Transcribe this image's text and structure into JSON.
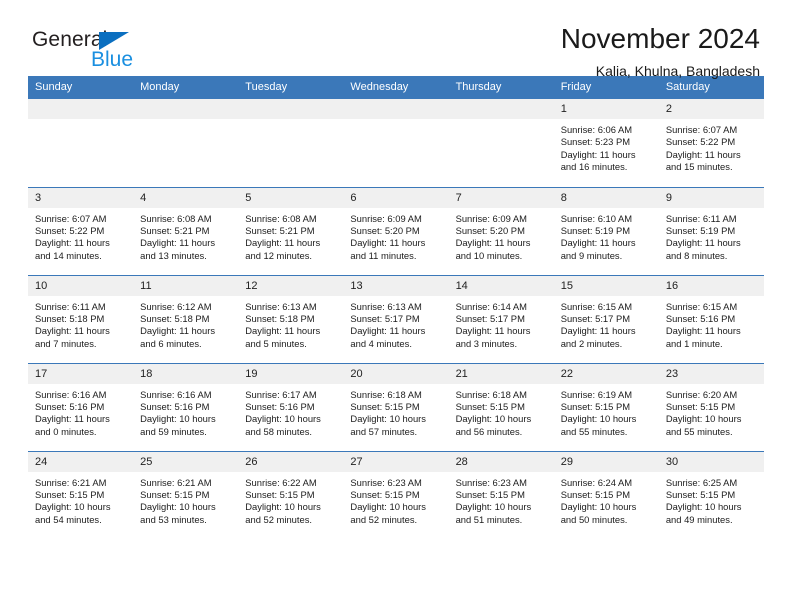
{
  "brand": {
    "name_dark": "General",
    "name_light": "Blue",
    "accent_color": "#1a8fe0",
    "flag_color": "#0b6fc0"
  },
  "header": {
    "title": "November 2024",
    "location": "Kalia, Khulna, Bangladesh"
  },
  "calendar": {
    "header_color": "#3b78b9",
    "daynum_bg": "#f0f0f0",
    "weekday_headers": [
      "Sunday",
      "Monday",
      "Tuesday",
      "Wednesday",
      "Thursday",
      "Friday",
      "Saturday"
    ],
    "weeks": [
      [
        {
          "day": "",
          "empty": true
        },
        {
          "day": "",
          "empty": true
        },
        {
          "day": "",
          "empty": true
        },
        {
          "day": "",
          "empty": true
        },
        {
          "day": "",
          "empty": true
        },
        {
          "day": "1",
          "sunrise": "Sunrise: 6:06 AM",
          "sunset": "Sunset: 5:23 PM",
          "daylight": "Daylight: 11 hours and 16 minutes."
        },
        {
          "day": "2",
          "sunrise": "Sunrise: 6:07 AM",
          "sunset": "Sunset: 5:22 PM",
          "daylight": "Daylight: 11 hours and 15 minutes."
        }
      ],
      [
        {
          "day": "3",
          "sunrise": "Sunrise: 6:07 AM",
          "sunset": "Sunset: 5:22 PM",
          "daylight": "Daylight: 11 hours and 14 minutes."
        },
        {
          "day": "4",
          "sunrise": "Sunrise: 6:08 AM",
          "sunset": "Sunset: 5:21 PM",
          "daylight": "Daylight: 11 hours and 13 minutes."
        },
        {
          "day": "5",
          "sunrise": "Sunrise: 6:08 AM",
          "sunset": "Sunset: 5:21 PM",
          "daylight": "Daylight: 11 hours and 12 minutes."
        },
        {
          "day": "6",
          "sunrise": "Sunrise: 6:09 AM",
          "sunset": "Sunset: 5:20 PM",
          "daylight": "Daylight: 11 hours and 11 minutes."
        },
        {
          "day": "7",
          "sunrise": "Sunrise: 6:09 AM",
          "sunset": "Sunset: 5:20 PM",
          "daylight": "Daylight: 11 hours and 10 minutes."
        },
        {
          "day": "8",
          "sunrise": "Sunrise: 6:10 AM",
          "sunset": "Sunset: 5:19 PM",
          "daylight": "Daylight: 11 hours and 9 minutes."
        },
        {
          "day": "9",
          "sunrise": "Sunrise: 6:11 AM",
          "sunset": "Sunset: 5:19 PM",
          "daylight": "Daylight: 11 hours and 8 minutes."
        }
      ],
      [
        {
          "day": "10",
          "sunrise": "Sunrise: 6:11 AM",
          "sunset": "Sunset: 5:18 PM",
          "daylight": "Daylight: 11 hours and 7 minutes."
        },
        {
          "day": "11",
          "sunrise": "Sunrise: 6:12 AM",
          "sunset": "Sunset: 5:18 PM",
          "daylight": "Daylight: 11 hours and 6 minutes."
        },
        {
          "day": "12",
          "sunrise": "Sunrise: 6:13 AM",
          "sunset": "Sunset: 5:18 PM",
          "daylight": "Daylight: 11 hours and 5 minutes."
        },
        {
          "day": "13",
          "sunrise": "Sunrise: 6:13 AM",
          "sunset": "Sunset: 5:17 PM",
          "daylight": "Daylight: 11 hours and 4 minutes."
        },
        {
          "day": "14",
          "sunrise": "Sunrise: 6:14 AM",
          "sunset": "Sunset: 5:17 PM",
          "daylight": "Daylight: 11 hours and 3 minutes."
        },
        {
          "day": "15",
          "sunrise": "Sunrise: 6:15 AM",
          "sunset": "Sunset: 5:17 PM",
          "daylight": "Daylight: 11 hours and 2 minutes."
        },
        {
          "day": "16",
          "sunrise": "Sunrise: 6:15 AM",
          "sunset": "Sunset: 5:16 PM",
          "daylight": "Daylight: 11 hours and 1 minute."
        }
      ],
      [
        {
          "day": "17",
          "sunrise": "Sunrise: 6:16 AM",
          "sunset": "Sunset: 5:16 PM",
          "daylight": "Daylight: 11 hours and 0 minutes."
        },
        {
          "day": "18",
          "sunrise": "Sunrise: 6:16 AM",
          "sunset": "Sunset: 5:16 PM",
          "daylight": "Daylight: 10 hours and 59 minutes."
        },
        {
          "day": "19",
          "sunrise": "Sunrise: 6:17 AM",
          "sunset": "Sunset: 5:16 PM",
          "daylight": "Daylight: 10 hours and 58 minutes."
        },
        {
          "day": "20",
          "sunrise": "Sunrise: 6:18 AM",
          "sunset": "Sunset: 5:15 PM",
          "daylight": "Daylight: 10 hours and 57 minutes."
        },
        {
          "day": "21",
          "sunrise": "Sunrise: 6:18 AM",
          "sunset": "Sunset: 5:15 PM",
          "daylight": "Daylight: 10 hours and 56 minutes."
        },
        {
          "day": "22",
          "sunrise": "Sunrise: 6:19 AM",
          "sunset": "Sunset: 5:15 PM",
          "daylight": "Daylight: 10 hours and 55 minutes."
        },
        {
          "day": "23",
          "sunrise": "Sunrise: 6:20 AM",
          "sunset": "Sunset: 5:15 PM",
          "daylight": "Daylight: 10 hours and 55 minutes."
        }
      ],
      [
        {
          "day": "24",
          "sunrise": "Sunrise: 6:21 AM",
          "sunset": "Sunset: 5:15 PM",
          "daylight": "Daylight: 10 hours and 54 minutes."
        },
        {
          "day": "25",
          "sunrise": "Sunrise: 6:21 AM",
          "sunset": "Sunset: 5:15 PM",
          "daylight": "Daylight: 10 hours and 53 minutes."
        },
        {
          "day": "26",
          "sunrise": "Sunrise: 6:22 AM",
          "sunset": "Sunset: 5:15 PM",
          "daylight": "Daylight: 10 hours and 52 minutes."
        },
        {
          "day": "27",
          "sunrise": "Sunrise: 6:23 AM",
          "sunset": "Sunset: 5:15 PM",
          "daylight": "Daylight: 10 hours and 52 minutes."
        },
        {
          "day": "28",
          "sunrise": "Sunrise: 6:23 AM",
          "sunset": "Sunset: 5:15 PM",
          "daylight": "Daylight: 10 hours and 51 minutes."
        },
        {
          "day": "29",
          "sunrise": "Sunrise: 6:24 AM",
          "sunset": "Sunset: 5:15 PM",
          "daylight": "Daylight: 10 hours and 50 minutes."
        },
        {
          "day": "30",
          "sunrise": "Sunrise: 6:25 AM",
          "sunset": "Sunset: 5:15 PM",
          "daylight": "Daylight: 10 hours and 49 minutes."
        }
      ]
    ]
  }
}
